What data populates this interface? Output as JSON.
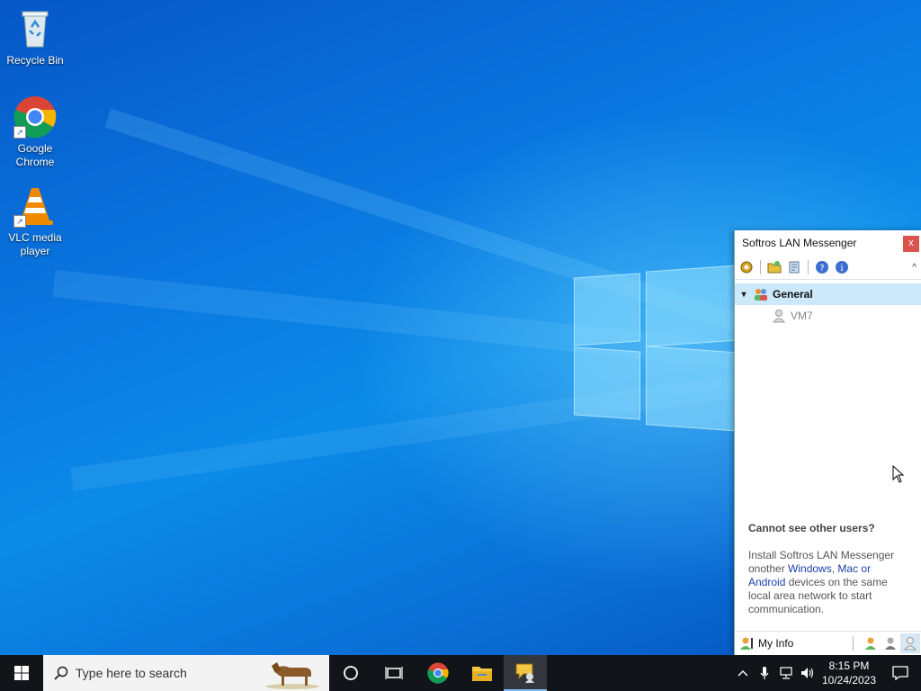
{
  "desktop": {
    "icons": [
      {
        "label": "Recycle Bin",
        "icon": "recycle-bin-icon"
      },
      {
        "label": "Google Chrome",
        "icon": "chrome-icon"
      },
      {
        "label": "VLC media player",
        "icon": "vlc-icon"
      }
    ]
  },
  "messenger": {
    "title": "Softros LAN Messenger",
    "close_label": "x",
    "toolbar_collapse": "^",
    "group": {
      "name": "General",
      "expanded": true
    },
    "users": [
      {
        "name": "VM7",
        "status": "offline"
      }
    ],
    "help": {
      "title": "Cannot see other users?",
      "text_before": "Install Softros LAN Messenger onother ",
      "link_windows": "Windows",
      "sep1": ", ",
      "link_mac": "Mac",
      "sep2": " or ",
      "link_android": "Android",
      "text_after": " devices on the same local area network to start communication."
    },
    "footer": {
      "my_info_label": "My Info"
    }
  },
  "taskbar": {
    "search_placeholder": "Type here to search",
    "clock_time": "8:15 PM",
    "clock_date": "10/24/2023"
  },
  "colors": {
    "taskbar": "#111419",
    "group_highlight": "#cde8f8",
    "link": "#1a3fa8",
    "close": "#d9534f"
  }
}
